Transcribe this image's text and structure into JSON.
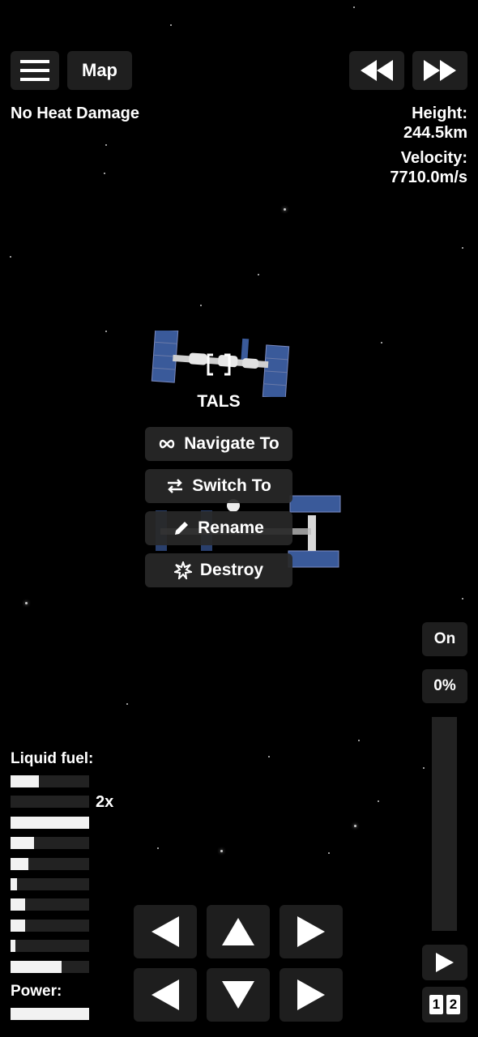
{
  "top_bar": {
    "menu_icon": "hamburger-icon",
    "map_label": "Map",
    "rewind_icon": "rewind-icon",
    "fast_forward_icon": "fast-forward-icon"
  },
  "status": {
    "heat": "No Heat Damage",
    "height_label": "Height:",
    "height_value": "244.5km",
    "velocity_label": "Velocity:",
    "velocity_value": "7710.0m/s"
  },
  "vessel": {
    "name": "TALS",
    "target_icon": "target-bracket-icon"
  },
  "context_menu": {
    "navigate": "Navigate To",
    "switch": "Switch To",
    "rename": "Rename",
    "destroy": "Destroy"
  },
  "fuel": {
    "label": "Liquid fuel:",
    "multiplier": "2x",
    "levels": [
      0.36,
      0,
      1.0,
      0.3,
      0.23,
      0.08,
      0.19,
      0.19,
      0.06,
      0.65
    ]
  },
  "power": {
    "label": "Power:",
    "level": 1.0
  },
  "throttle": {
    "toggle": "On",
    "percent": "0%",
    "level": 0
  },
  "controls": {
    "play_icon": "play-icon",
    "stage_1": "1",
    "stage_2": "2"
  }
}
